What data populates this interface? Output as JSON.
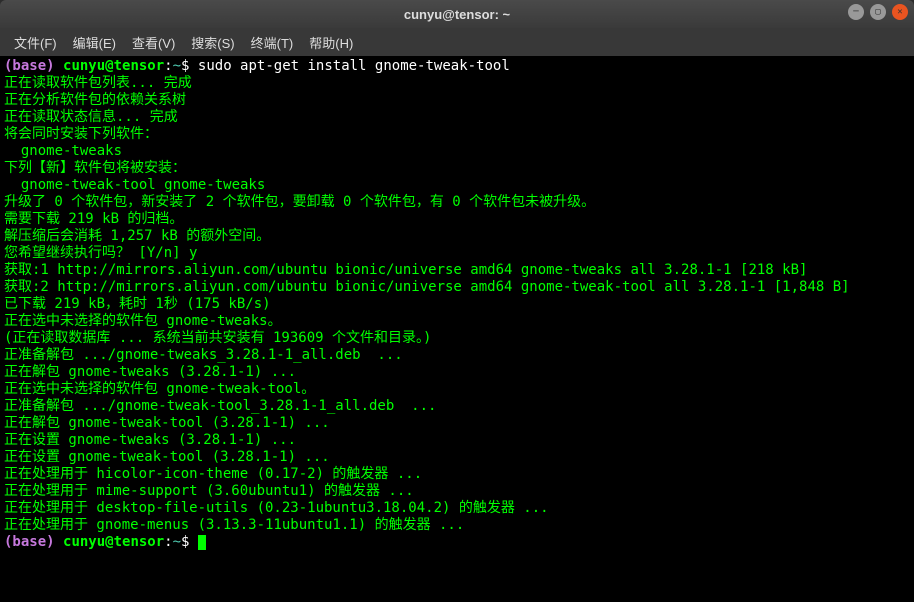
{
  "window": {
    "title": "cunyu@tensor: ~"
  },
  "menu": {
    "file": "文件(F)",
    "edit": "编辑(E)",
    "view": "查看(V)",
    "search": "搜索(S)",
    "terminal": "终端(T)",
    "help": "帮助(H)"
  },
  "prompt": {
    "env": "(base)",
    "userhost": "cunyu@tensor",
    "sep": ":",
    "path": "~",
    "dollar": "$"
  },
  "cmd1": " sudo apt-get install gnome-tweak-tool",
  "lines": {
    "l1": "正在读取软件包列表... 完成",
    "l2": "正在分析软件包的依赖关系树       ",
    "l3": "正在读取状态信息... 完成       ",
    "l4": "将会同时安装下列软件：",
    "l5": "  gnome-tweaks",
    "l6": "下列【新】软件包将被安装：",
    "l7": "  gnome-tweak-tool gnome-tweaks",
    "l8": "升级了 0 个软件包，新安装了 2 个软件包，要卸载 0 个软件包，有 0 个软件包未被升级。",
    "l9": "需要下载 219 kB 的归档。",
    "l10": "解压缩后会消耗 1,257 kB 的额外空间。",
    "l11": "您希望继续执行吗？ [Y/n] y",
    "l12": "获取:1 http://mirrors.aliyun.com/ubuntu bionic/universe amd64 gnome-tweaks all 3.28.1-1 [218 kB]",
    "l13": "获取:2 http://mirrors.aliyun.com/ubuntu bionic/universe amd64 gnome-tweak-tool all 3.28.1-1 [1,848 B]",
    "l14": "已下载 219 kB，耗时 1秒 (175 kB/s)",
    "l15": "正在选中未选择的软件包 gnome-tweaks。",
    "l16": "(正在读取数据库 ... 系统当前共安装有 193609 个文件和目录。)",
    "l17": "正准备解包 .../gnome-tweaks_3.28.1-1_all.deb  ...",
    "l18": "正在解包 gnome-tweaks (3.28.1-1) ...",
    "l19": "正在选中未选择的软件包 gnome-tweak-tool。",
    "l20": "正准备解包 .../gnome-tweak-tool_3.28.1-1_all.deb  ...",
    "l21": "正在解包 gnome-tweak-tool (3.28.1-1) ...",
    "l22": "正在设置 gnome-tweaks (3.28.1-1) ...",
    "l23": "正在设置 gnome-tweak-tool (3.28.1-1) ...",
    "l24": "正在处理用于 hicolor-icon-theme (0.17-2) 的触发器 ...",
    "l25": "正在处理用于 mime-support (3.60ubuntu1) 的触发器 ...",
    "l26": "正在处理用于 desktop-file-utils (0.23-1ubuntu3.18.04.2) 的触发器 ...",
    "l27": "正在处理用于 gnome-menus (3.13.3-11ubuntu1.1) 的触发器 ..."
  }
}
